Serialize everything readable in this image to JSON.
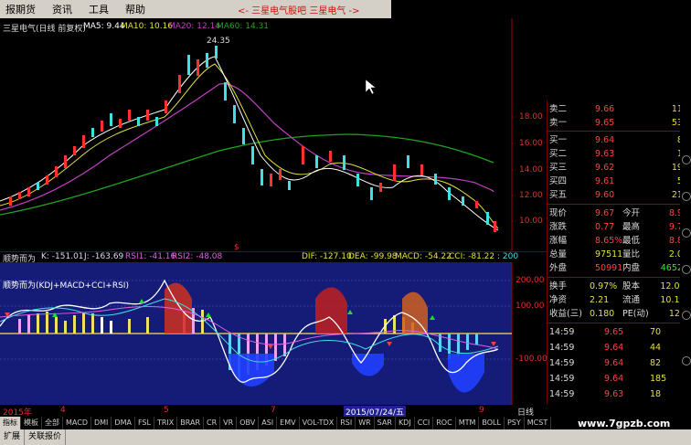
{
  "menu": [
    "报期货",
    "资讯",
    "工具",
    "帮助"
  ],
  "promo": "<- 三星电气股吧 三星电气 ->",
  "chart": {
    "title": "三星电气(日线 前复权)",
    "ma5": "MA5: 9.44",
    "ma10": "MA10: 10.16",
    "ma20": "MA20: 12.14",
    "ma60": "MA60: 14.31",
    "peak_label": "24.35",
    "price_axis": [
      "18.00",
      "16.00",
      "14.00",
      "12.00",
      "10.00"
    ],
    "dollar": "$"
  },
  "indicator": {
    "name": "顺势而为",
    "k": "K: -151.01",
    "j": "J: -163.69",
    "rsi1": "RSI1: -41.16",
    "rsi2": "RSI2: -48.08",
    "dif": "DIF: -127.10",
    "dea": "DEA: -99.98",
    "macd": "MACD: -54.22",
    "cci": "CCI: -81.22",
    "extra": ": 200",
    "sub": "顺势而为(KDJ+MACD+CCI+RSI)",
    "axis": [
      "200.00",
      "100.00",
      "-100.00"
    ]
  },
  "dates": {
    "year": "2015年",
    "months": [
      "4",
      "5",
      "7",
      "9"
    ],
    "cursor": "2015/07/24/五",
    "period": "日线"
  },
  "quote": {
    "sell": [
      {
        "label": "卖二",
        "price": "9.66",
        "vol": "110"
      },
      {
        "label": "卖一",
        "price": "9.65",
        "vol": "538"
      }
    ],
    "buy": [
      {
        "label": "买一",
        "price": "9.64",
        "vol": "84"
      },
      {
        "label": "买二",
        "price": "9.63",
        "vol": "10"
      },
      {
        "label": "买三",
        "price": "9.62",
        "vol": "196"
      },
      {
        "label": "买四",
        "price": "9.61",
        "vol": "53"
      },
      {
        "label": "买五",
        "price": "9.60",
        "vol": "215"
      }
    ],
    "stats": [
      {
        "l1": "现价",
        "v1": "9.67",
        "l2": "今开",
        "v2": "8.90"
      },
      {
        "l1": "涨跌",
        "v1": "0.77",
        "l2": "最高",
        "v2": "9.79"
      },
      {
        "l1": "涨幅",
        "v1": "8.65%",
        "l2": "最低",
        "v2": "8.88"
      },
      {
        "l1": "总量",
        "v1": "97511",
        "l2": "量比",
        "v2": "2.05"
      },
      {
        "l1": "外盘",
        "v1": "50991",
        "l2": "内盘",
        "v2": "46520"
      }
    ],
    "info": [
      {
        "l1": "换手",
        "v1": "0.97%",
        "l2": "股本",
        "v2": "12.0亿"
      },
      {
        "l1": "净资",
        "v1": "2.21",
        "l2": "流通",
        "v2": "10.1亿"
      },
      {
        "l1": "收益(三)",
        "v1": "0.180",
        "l2": "PE(动)",
        "v2": "12.5"
      }
    ],
    "ticks": [
      {
        "time": "14:59",
        "price": "9.65",
        "vol": "70",
        "side": "S"
      },
      {
        "time": "14:59",
        "price": "9.64",
        "vol": "44",
        "side": "S"
      },
      {
        "time": "14:59",
        "price": "9.64",
        "vol": "82",
        "side": "S"
      },
      {
        "time": "14:59",
        "price": "9.64",
        "vol": "185",
        "side": "S"
      },
      {
        "time": "14:59",
        "price": "9.63",
        "vol": "18",
        "side": "B"
      }
    ]
  },
  "tabs": [
    "指标",
    "模板",
    "全部",
    "MACD",
    "DMI",
    "DMA",
    "FSL",
    "TRIX",
    "BRAR",
    "CR",
    "VR",
    "OBV",
    "ASI",
    "EMV",
    "VOL-TDX",
    "RSI",
    "WR",
    "SAR",
    "KDJ",
    "CCI",
    "ROC",
    "MTM",
    "BOLL",
    "PSY",
    "MCST"
  ],
  "tabs_bottom": [
    "扩展",
    "关联报价"
  ],
  "watermark": "www.7gpzb.com"
}
